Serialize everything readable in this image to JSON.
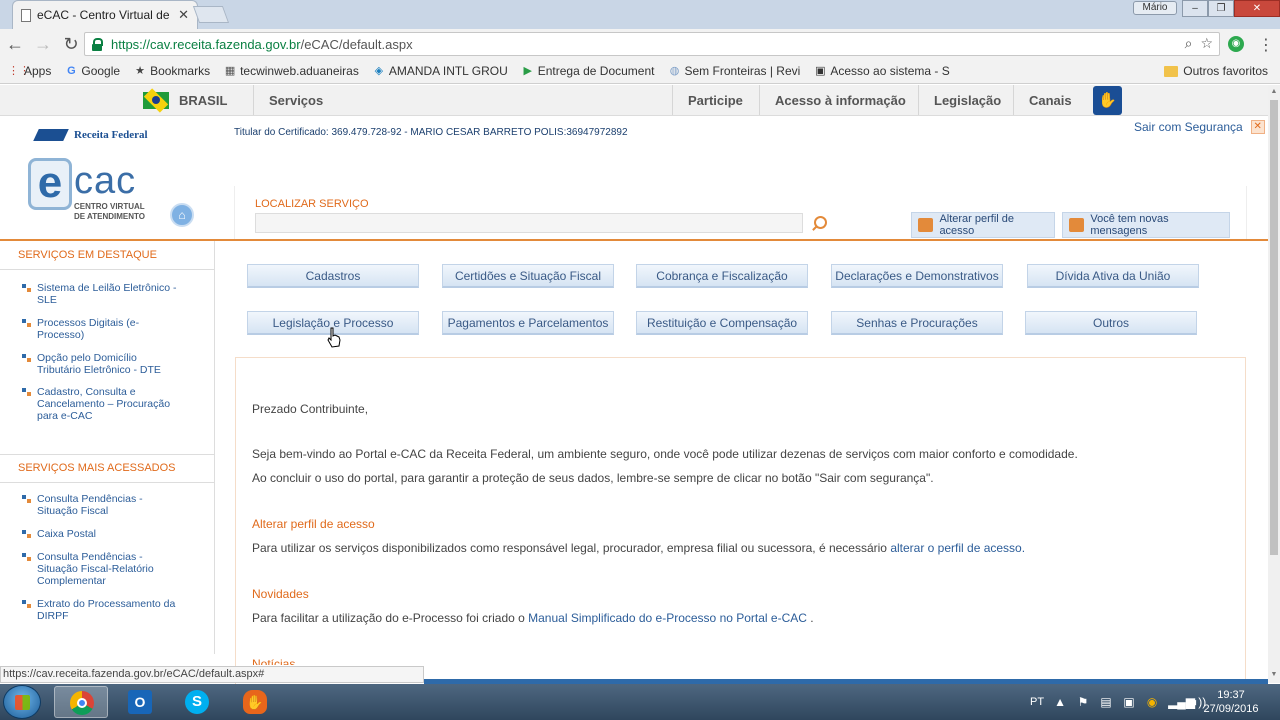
{
  "browser": {
    "tab_title": "eCAC - Centro Virtual de",
    "profile_name": "Mário",
    "url_secure_part": "https://cav.receita.fazenda.gov.br",
    "url_rest": "/eCAC/default.aspx",
    "bookmarks": [
      {
        "label": "Apps",
        "icon": "apps-grid-icon"
      },
      {
        "label": "Google",
        "icon": "google-icon"
      },
      {
        "label": "Bookmarks",
        "icon": "star-icon"
      },
      {
        "label": "tecwinweb.aduaneiras",
        "icon": "site-icon"
      },
      {
        "label": "AMANDA INTL GROU",
        "icon": "site-icon"
      },
      {
        "label": "Entrega de Document",
        "icon": "site-icon"
      },
      {
        "label": "Sem Fronteiras | Revi",
        "icon": "site-icon"
      },
      {
        "label": "Acesso ao sistema - S",
        "icon": "site-icon"
      }
    ],
    "other_bookmarks": "Outros favoritos",
    "status_url": "https://cav.receita.fazenda.gov.br/eCAC/default.aspx#"
  },
  "gov_bar": {
    "country": "BRASIL",
    "services": "Serviços",
    "links": [
      "Participe",
      "Acesso à informação",
      "Legislação",
      "Canais"
    ]
  },
  "header": {
    "agency": "Receita Federal",
    "titular": "Titular do Certificado: 369.479.728-92 - MARIO CESAR BARRETO POLIS:36947972892",
    "logout": "Sair com Segurança",
    "logo_e": "e",
    "logo_cac": "cac",
    "logo_sub_lines": [
      "CENTRO VIRTUAL",
      "DE ATENDIMENTO"
    ],
    "search_label": "LOCALIZAR SERVIÇO",
    "change_profile": "Alterar perfil de acesso",
    "messages": "Você tem novas mensagens"
  },
  "sidebar": {
    "featured_title": "SERVIÇOS EM DESTAQUE",
    "featured": [
      "Sistema de Leilão Eletrônico - SLE",
      "Processos Digitais (e-Processo)",
      "Opção pelo Domicílio Tributário Eletrônico - DTE",
      "Cadastro, Consulta e Cancelamento – Procuração para e-CAC"
    ],
    "most_accessed_title": "SERVIÇOS MAIS ACESSADOS",
    "most_accessed": [
      "Consulta Pendências - Situação Fiscal",
      "Caixa Postal",
      "Consulta Pendências - Situação Fiscal-Relatório Complementar",
      "Extrato do Processamento da DIRPF"
    ]
  },
  "services_row1": [
    "Cadastros",
    "Certidões e Situação Fiscal",
    "Cobrança e Fiscalização",
    "Declarações e Demonstrativos",
    "Dívida Ativa da União"
  ],
  "services_row2": [
    "Legislação e Processo",
    "Pagamentos e Parcelamentos",
    "Restituição e Compensação",
    "Senhas e Procurações",
    "Outros"
  ],
  "welcome": {
    "greeting": "Prezado Contribuinte,",
    "line1": "Seja bem-vindo ao Portal e-CAC da Receita Federal, um ambiente seguro, onde você pode utilizar dezenas de serviços com maior conforto e comodidade.",
    "line2": "Ao concluir o uso do portal, para garantir a proteção de seus dados, lembre-se sempre de clicar no botão \"Sair com segurança\".",
    "profile_heading": "Alterar perfil de acesso",
    "profile_text": "Para utilizar os serviços disponibilizados como responsável legal, procurador, empresa filial ou sucessora, é necessário ",
    "profile_link": "alterar o perfil de acesso.",
    "news_heading": "Novidades",
    "news_text": "Para facilitar a utilização do e-Processo foi criado o ",
    "news_link": "Manual Simplificado do e-Processo no Portal e-CAC",
    "news_end": " .",
    "next_heading": "Notícias"
  },
  "taskbar": {
    "lang": "PT",
    "time": "19:37",
    "date": "27/09/2016",
    "apps": [
      "chrome-icon",
      "outlook-icon",
      "skype-icon",
      "hand-app-icon"
    ]
  },
  "colors": {
    "accent_orange": "#e06a1b",
    "link_blue": "#2c5d99",
    "gov_blue": "#1b4f92"
  }
}
